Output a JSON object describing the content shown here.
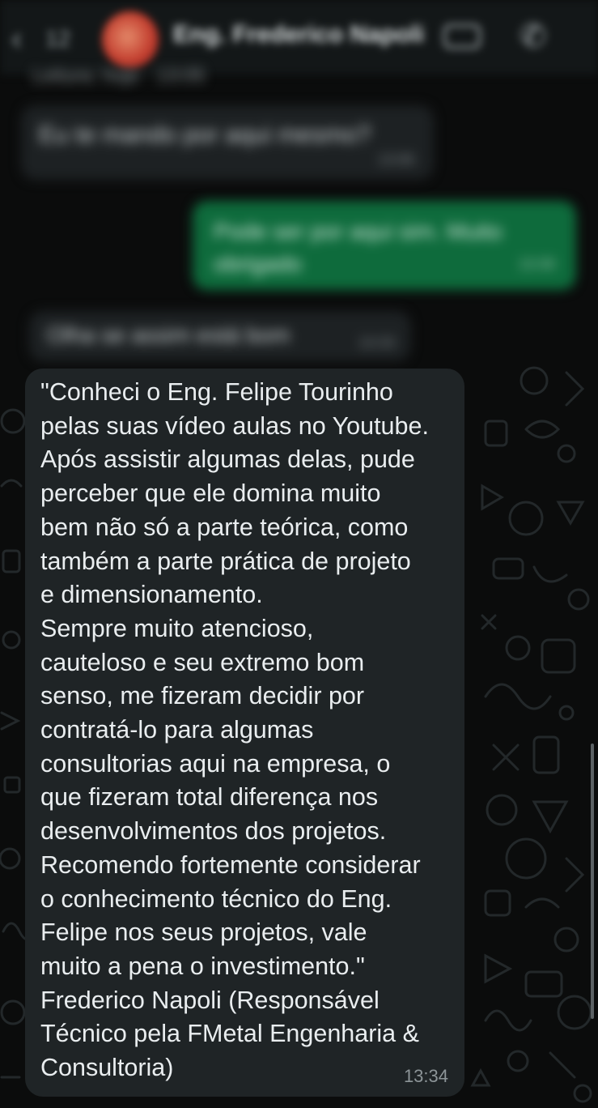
{
  "header": {
    "back_icon": "chevron-left-icon",
    "unread_count": "12",
    "contact_name": "Eng. Frederico Napoli",
    "video_icon": "video-camera-icon",
    "call_icon": "phone-icon"
  },
  "blurred_messages": {
    "meta_line": "Leitura: hoje · 13:05",
    "incoming_1": {
      "text": "Eu te mando por aqui mesmo?",
      "time": "13:06"
    },
    "outgoing_1": {
      "text": "Pode ser por aqui sim. Muito obrigado",
      "time": "13:30"
    },
    "incoming_2": {
      "text": "Olha se assim está bom",
      "time": "13:33"
    }
  },
  "message": {
    "text": "\"Conheci o Eng. Felipe Tourinho\npelas suas vídeo aulas no Youtube.\nApós assistir algumas delas, pude\nperceber que ele domina muito\nbem não só a parte teórica, como\ntambém a parte prática de projeto\ne dimensionamento.\nSempre muito atencioso,\ncauteloso e seu extremo bom\nsenso, me fizeram decidir por\ncontratá-lo para algumas\nconsultorias aqui na empresa, o\nque fizeram total diferença nos\ndesenvolvimentos dos projetos.\nRecomendo fortemente considerar\no conhecimento técnico do Eng.\nFelipe nos seus projetos, vale\nmuito a pena o investimento.\"\nFrederico Napoli (Responsável\nTécnico pela FMetal Engenharia &\nConsultoria)",
    "time": "13:34"
  },
  "colors": {
    "background": "#0b0c0c",
    "incoming_bubble": "#1f2426",
    "outgoing_bubble": "#0e6b3c",
    "message_text": "#e9edef",
    "timestamp": "#8d9598"
  }
}
